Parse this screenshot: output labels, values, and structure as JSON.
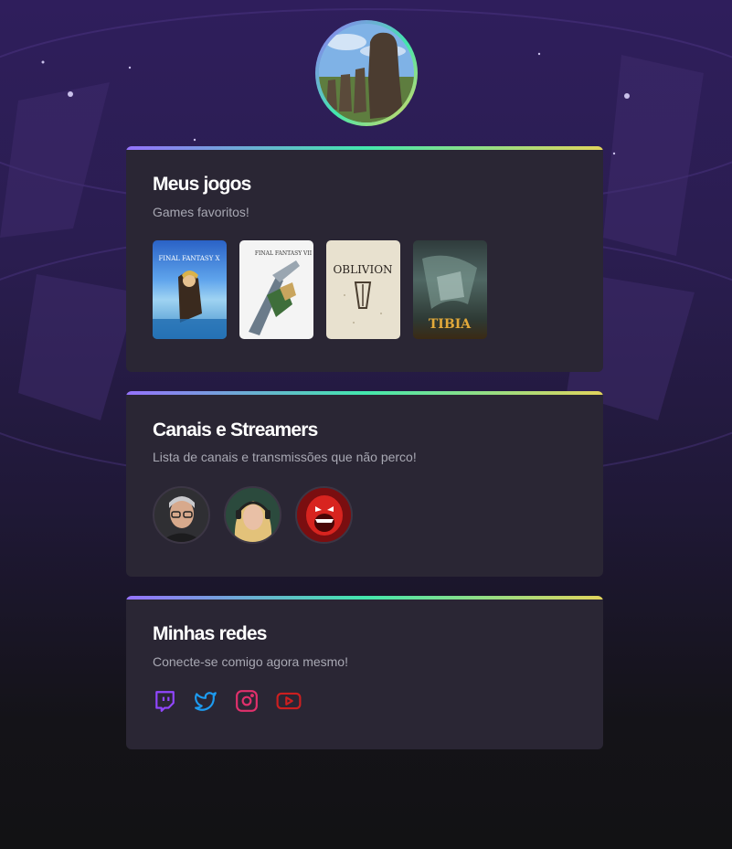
{
  "profile": {
    "avatar_icon": "moai-photo-avatar"
  },
  "games_card": {
    "title": "Meus jogos",
    "subtitle": "Games favoritos!",
    "games": [
      {
        "name": "FINAL FANTASY X",
        "icon": "final-fantasy-x-cover"
      },
      {
        "name": "FINAL FANTASY VII",
        "icon": "final-fantasy-vii-cover"
      },
      {
        "name": "OBLIVION",
        "icon": "oblivion-cover"
      },
      {
        "name": "TIBIA",
        "icon": "tibia-cover"
      }
    ]
  },
  "streamers_card": {
    "title": "Canais e Streamers",
    "subtitle": "Lista de canais e transmissões que não perco!",
    "streamers": [
      {
        "icon": "streamer-man-glasses-avatar"
      },
      {
        "icon": "streamer-blonde-headset-avatar"
      },
      {
        "icon": "red-monster-avatar"
      }
    ]
  },
  "socials_card": {
    "title": "Minhas redes",
    "subtitle": "Conecte-se comigo agora mesmo!",
    "links": [
      {
        "icon": "twitch-icon",
        "color": "#9146ff"
      },
      {
        "icon": "twitter-icon",
        "color": "#1d9bf0"
      },
      {
        "icon": "instagram-icon",
        "color": "#e1306c"
      },
      {
        "icon": "youtube-icon",
        "color": "#cc1f1f"
      }
    ]
  },
  "colors": {
    "accent_gradient": [
      "#9572fc",
      "#43e7ad",
      "#e2d45c"
    ],
    "card_bg": "#2a2634",
    "subtitle": "#a8a8b3"
  }
}
